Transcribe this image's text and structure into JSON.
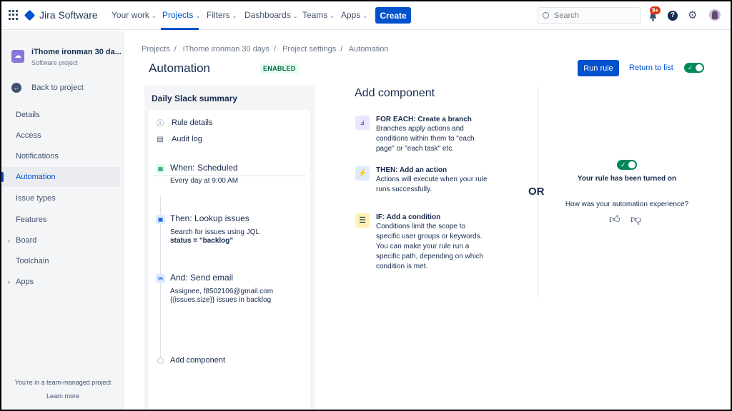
{
  "topnav": {
    "logo_text": "Jira Software",
    "items": [
      {
        "label": "Your work"
      },
      {
        "label": "Projects"
      },
      {
        "label": "Filters"
      },
      {
        "label": "Dashboards"
      },
      {
        "label": "Teams"
      },
      {
        "label": "Apps"
      }
    ],
    "create_label": "Create",
    "search_placeholder": "Search",
    "notification_count": "9+",
    "help_glyph": "?"
  },
  "sidebar": {
    "project_name": "iThome ironman 30 da...",
    "project_type": "Software project",
    "back_label": "Back to project",
    "items": [
      {
        "label": "Details"
      },
      {
        "label": "Access"
      },
      {
        "label": "Notifications"
      },
      {
        "label": "Automation"
      },
      {
        "label": "Issue types"
      },
      {
        "label": "Features"
      },
      {
        "label": "Board"
      },
      {
        "label": "Toolchain"
      },
      {
        "label": "Apps"
      }
    ],
    "footer_text": "You're in a team-managed project",
    "learn_more": "Learn more"
  },
  "breadcrumb": [
    "Projects",
    "iThome ironman 30 days",
    "Project settings",
    "Automation"
  ],
  "page": {
    "title": "Automation",
    "status": "ENABLED",
    "run_rule": "Run rule",
    "return_to_list": "Return to list"
  },
  "rule": {
    "name": "Daily Slack summary",
    "rule_details": "Rule details",
    "audit_log": "Audit log",
    "steps": [
      {
        "title": "When: Scheduled",
        "desc": "Every day at 9:00 AM",
        "desc2": ""
      },
      {
        "title": "Then: Lookup issues",
        "desc": "Search for issues using JQL",
        "desc2": "status = \"backlog\""
      },
      {
        "title": "And: Send email",
        "desc": "Assignee, f8502106@gmail.com",
        "desc2": "{{issues.size}} issues in backlog"
      }
    ],
    "add_component": "Add component"
  },
  "add_component": {
    "heading": "Add component",
    "items": [
      {
        "title": "FOR EACH: Create a branch",
        "desc": "Branches apply actions and conditions within them to \"each page\" or \"each task\" etc."
      },
      {
        "title": "THEN: Add an action",
        "desc": "Actions will execute when your rule runs successfully."
      },
      {
        "title": "IF: Add a condition",
        "desc": "Conditions limit the scope to specific user groups or keywords. You can make your rule run a specific path, depending on which condition is met."
      }
    ]
  },
  "or_label": "OR",
  "feedback": {
    "turned_on": "Your rule has been turned on",
    "question": "How was your automation experience?"
  },
  "colors": {
    "brand": "#0052CC",
    "toggle_on": "#00875A",
    "enabled_text": "#006644"
  }
}
